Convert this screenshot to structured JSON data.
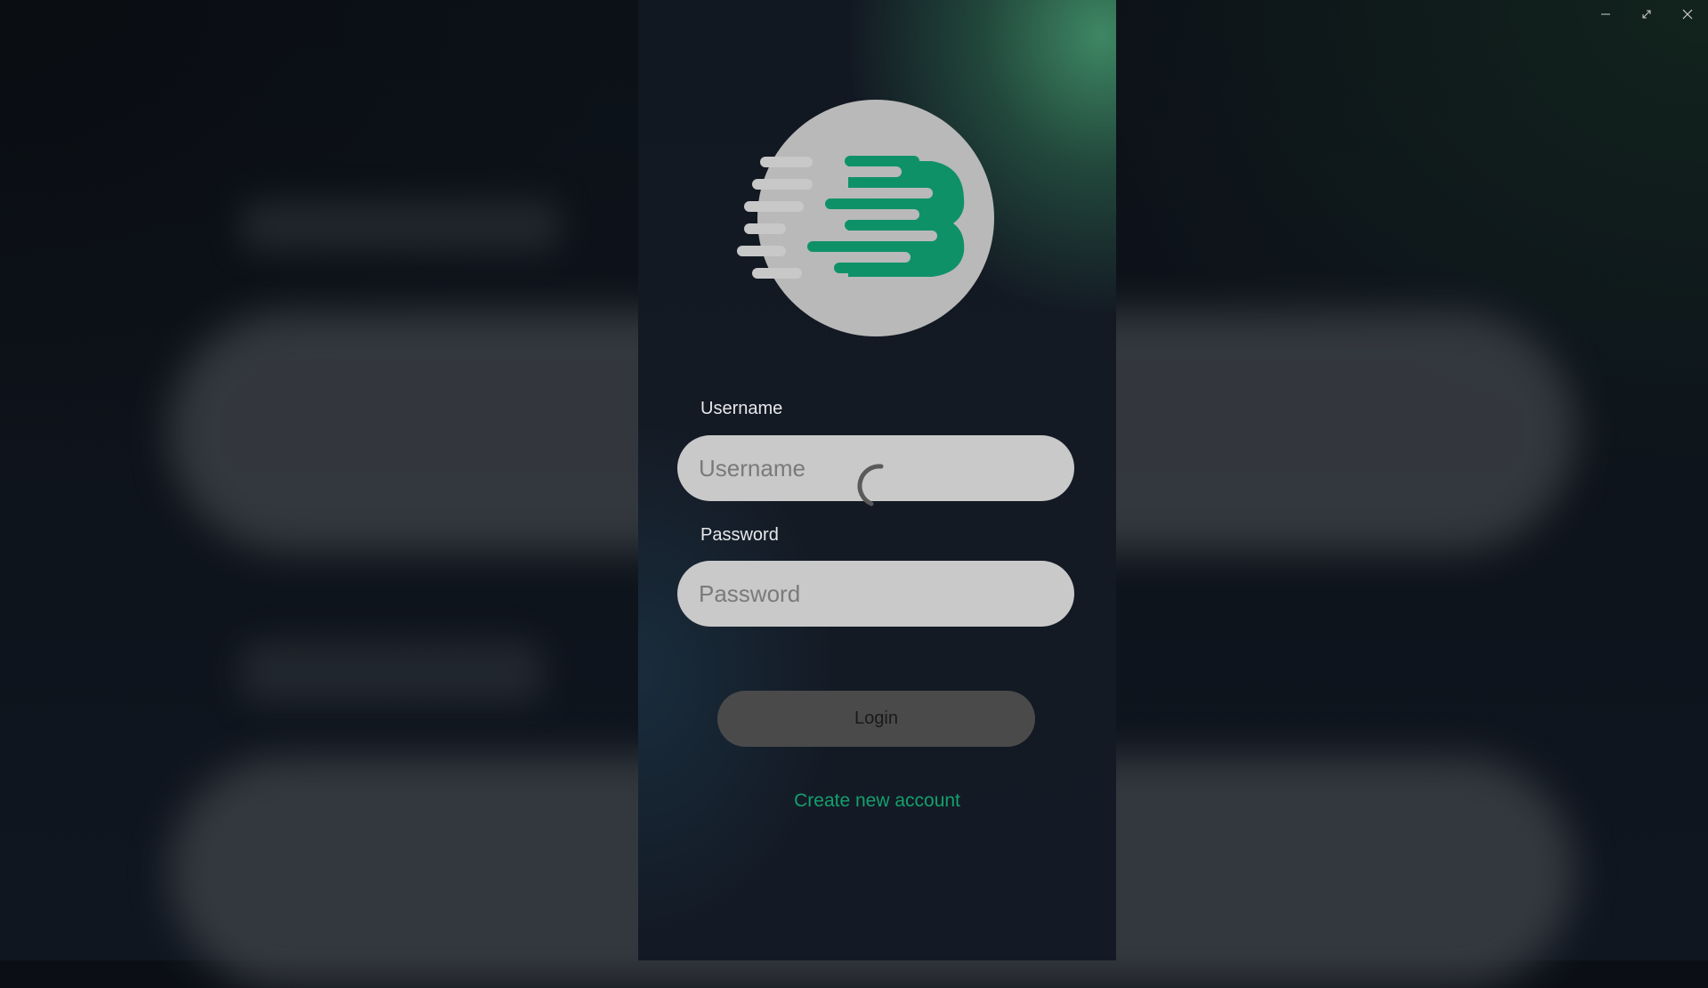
{
  "window": {
    "controls": [
      "minimize-icon",
      "restore-icon",
      "close-icon"
    ]
  },
  "login": {
    "logo": "brand-logo",
    "username": {
      "label": "Username",
      "placeholder": "Username",
      "value": ""
    },
    "password": {
      "label": "Password",
      "placeholder": "Password",
      "value": ""
    },
    "login_button": "Login",
    "create_account_link": "Create new account",
    "loading": true
  },
  "colors": {
    "accent": "#159f6d",
    "logo_green": "#0f9168",
    "logo_circle": "#b9b9b9",
    "input_bg": "#c9c9c9",
    "button_bg": "#4a4a4a"
  }
}
